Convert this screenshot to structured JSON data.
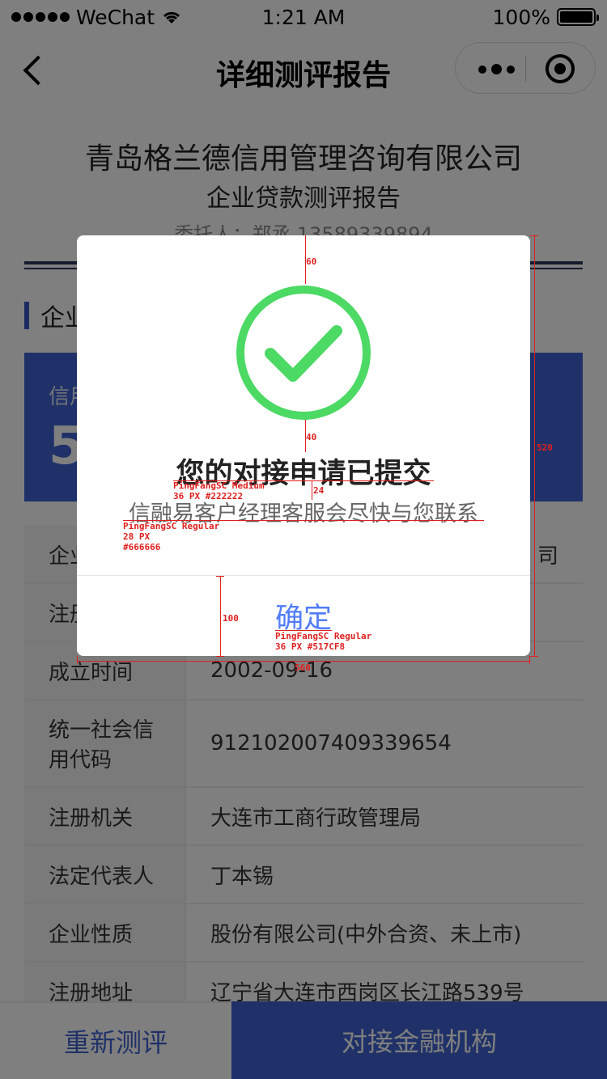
{
  "status_bar": {
    "carrier": "WeChat",
    "time": "1:21 AM",
    "battery": "100%",
    "battery_level": 1.0
  },
  "nav": {
    "title": "详细测评报告",
    "back_icon": "chevron-left-icon",
    "more_icon": "more-dots-icon",
    "close_icon": "target-close-icon"
  },
  "report": {
    "company": "青岛格兰德信用管理咨询有限公司",
    "title": "企业贷款测评报告",
    "client": "委托人：郑丞  13589339894",
    "section_label": "企业",
    "credit_label": "信用",
    "credit_score": "5"
  },
  "info_rows": [
    {
      "key": "企业",
      "value": "司"
    },
    {
      "key": "注册",
      "value": ""
    },
    {
      "key": "成立时间",
      "value": "2002-09-16"
    },
    {
      "key": "统一社会信用代码",
      "value": "912102007409339654"
    },
    {
      "key": "注册机关",
      "value": "大连市工商行政管理局"
    },
    {
      "key": "法定代表人",
      "value": "丁本锡"
    },
    {
      "key": "企业性质",
      "value": "股份有限公司(中外合资、未上市)"
    },
    {
      "key": "注册地址",
      "value": "辽宁省大连市西岗区长江路539号"
    }
  ],
  "bottom": {
    "retest": "重新测评",
    "connect": "对接金融机构"
  },
  "modal": {
    "icon": "check-circle-icon",
    "icon_color": "#4CD964",
    "title": "您的对接申请已提交",
    "desc": "信融易客户经理客服会尽快与您联系",
    "confirm": "确定",
    "confirm_color": "#517CF8"
  },
  "annotations": {
    "top_gap": "60",
    "icon_gap": "40",
    "title_gap": "24",
    "title_spec_font": "PingFangSC Medium",
    "title_spec_size": "36 PX #222222",
    "desc_spec_font": "PingFangSC Regular",
    "desc_spec_size": "28 PX",
    "desc_spec_color": "#666666",
    "button_height": "100",
    "button_spec_font": "PingFangSC Regular",
    "button_spec_size": "36 PX #517CF8",
    "modal_height": "520",
    "modal_width": "560"
  },
  "colors": {
    "primary": "#3f63d1",
    "overlay": "rgba(0,0,0,0.5)",
    "annotation": "#e02020"
  }
}
